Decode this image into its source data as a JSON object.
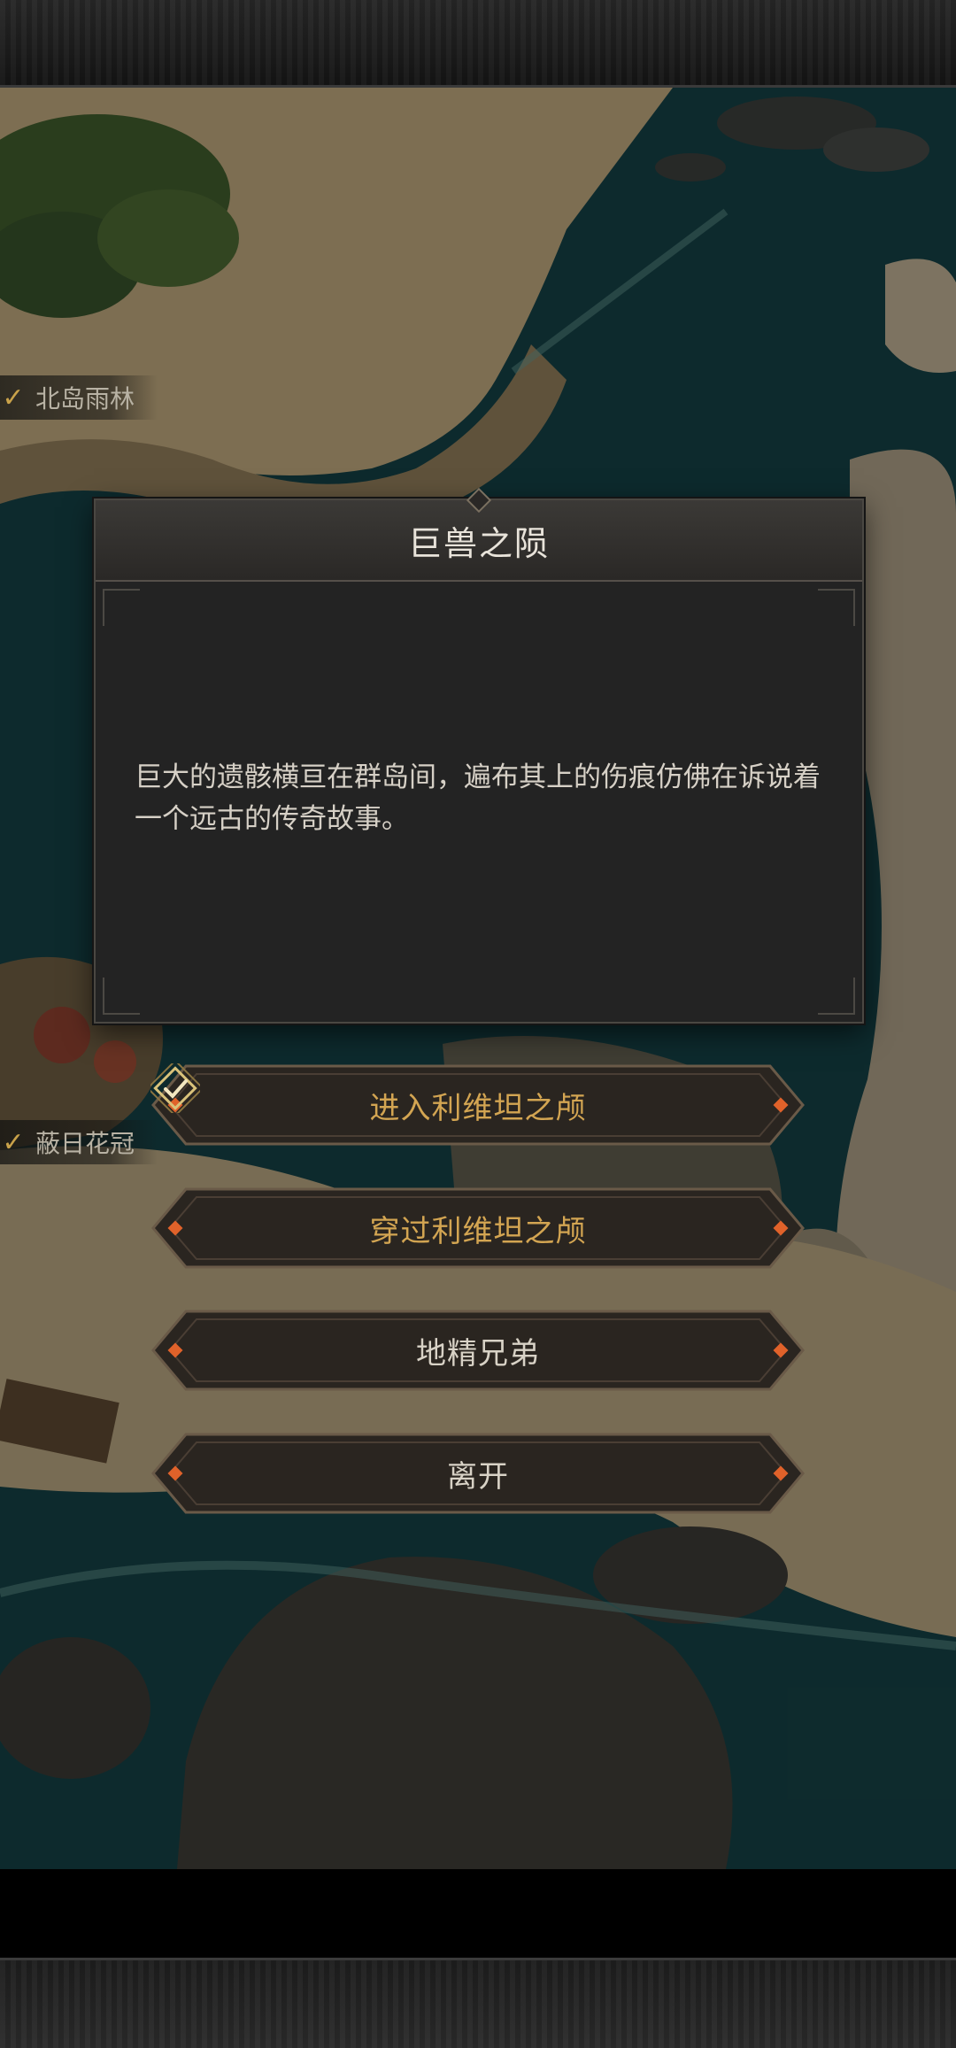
{
  "map": {
    "locations": [
      {
        "name": "北岛雨林",
        "visited": true
      },
      {
        "name": "蔽日花冠",
        "visited": true
      }
    ]
  },
  "dialog": {
    "title": "巨兽之陨",
    "body": "巨大的遗骸横亘在群岛间，遍布其上的伤痕仿佛在诉说着一个远古的传奇故事。"
  },
  "choices": [
    {
      "label": "进入利维坦之颅",
      "completed": true,
      "color": "#d3a552"
    },
    {
      "label": "穿过利维坦之颅",
      "completed": false,
      "color": "#d3a552"
    },
    {
      "label": "地精兄弟",
      "completed": false,
      "color": "#d8d2c6"
    },
    {
      "label": "离开",
      "completed": false,
      "color": "#d8d2c6"
    }
  ],
  "colors": {
    "accent_gold": "#c9a24a",
    "gem_orange": "#e0622a",
    "dialog_bg": "#232323",
    "sea": "#123a3d"
  }
}
